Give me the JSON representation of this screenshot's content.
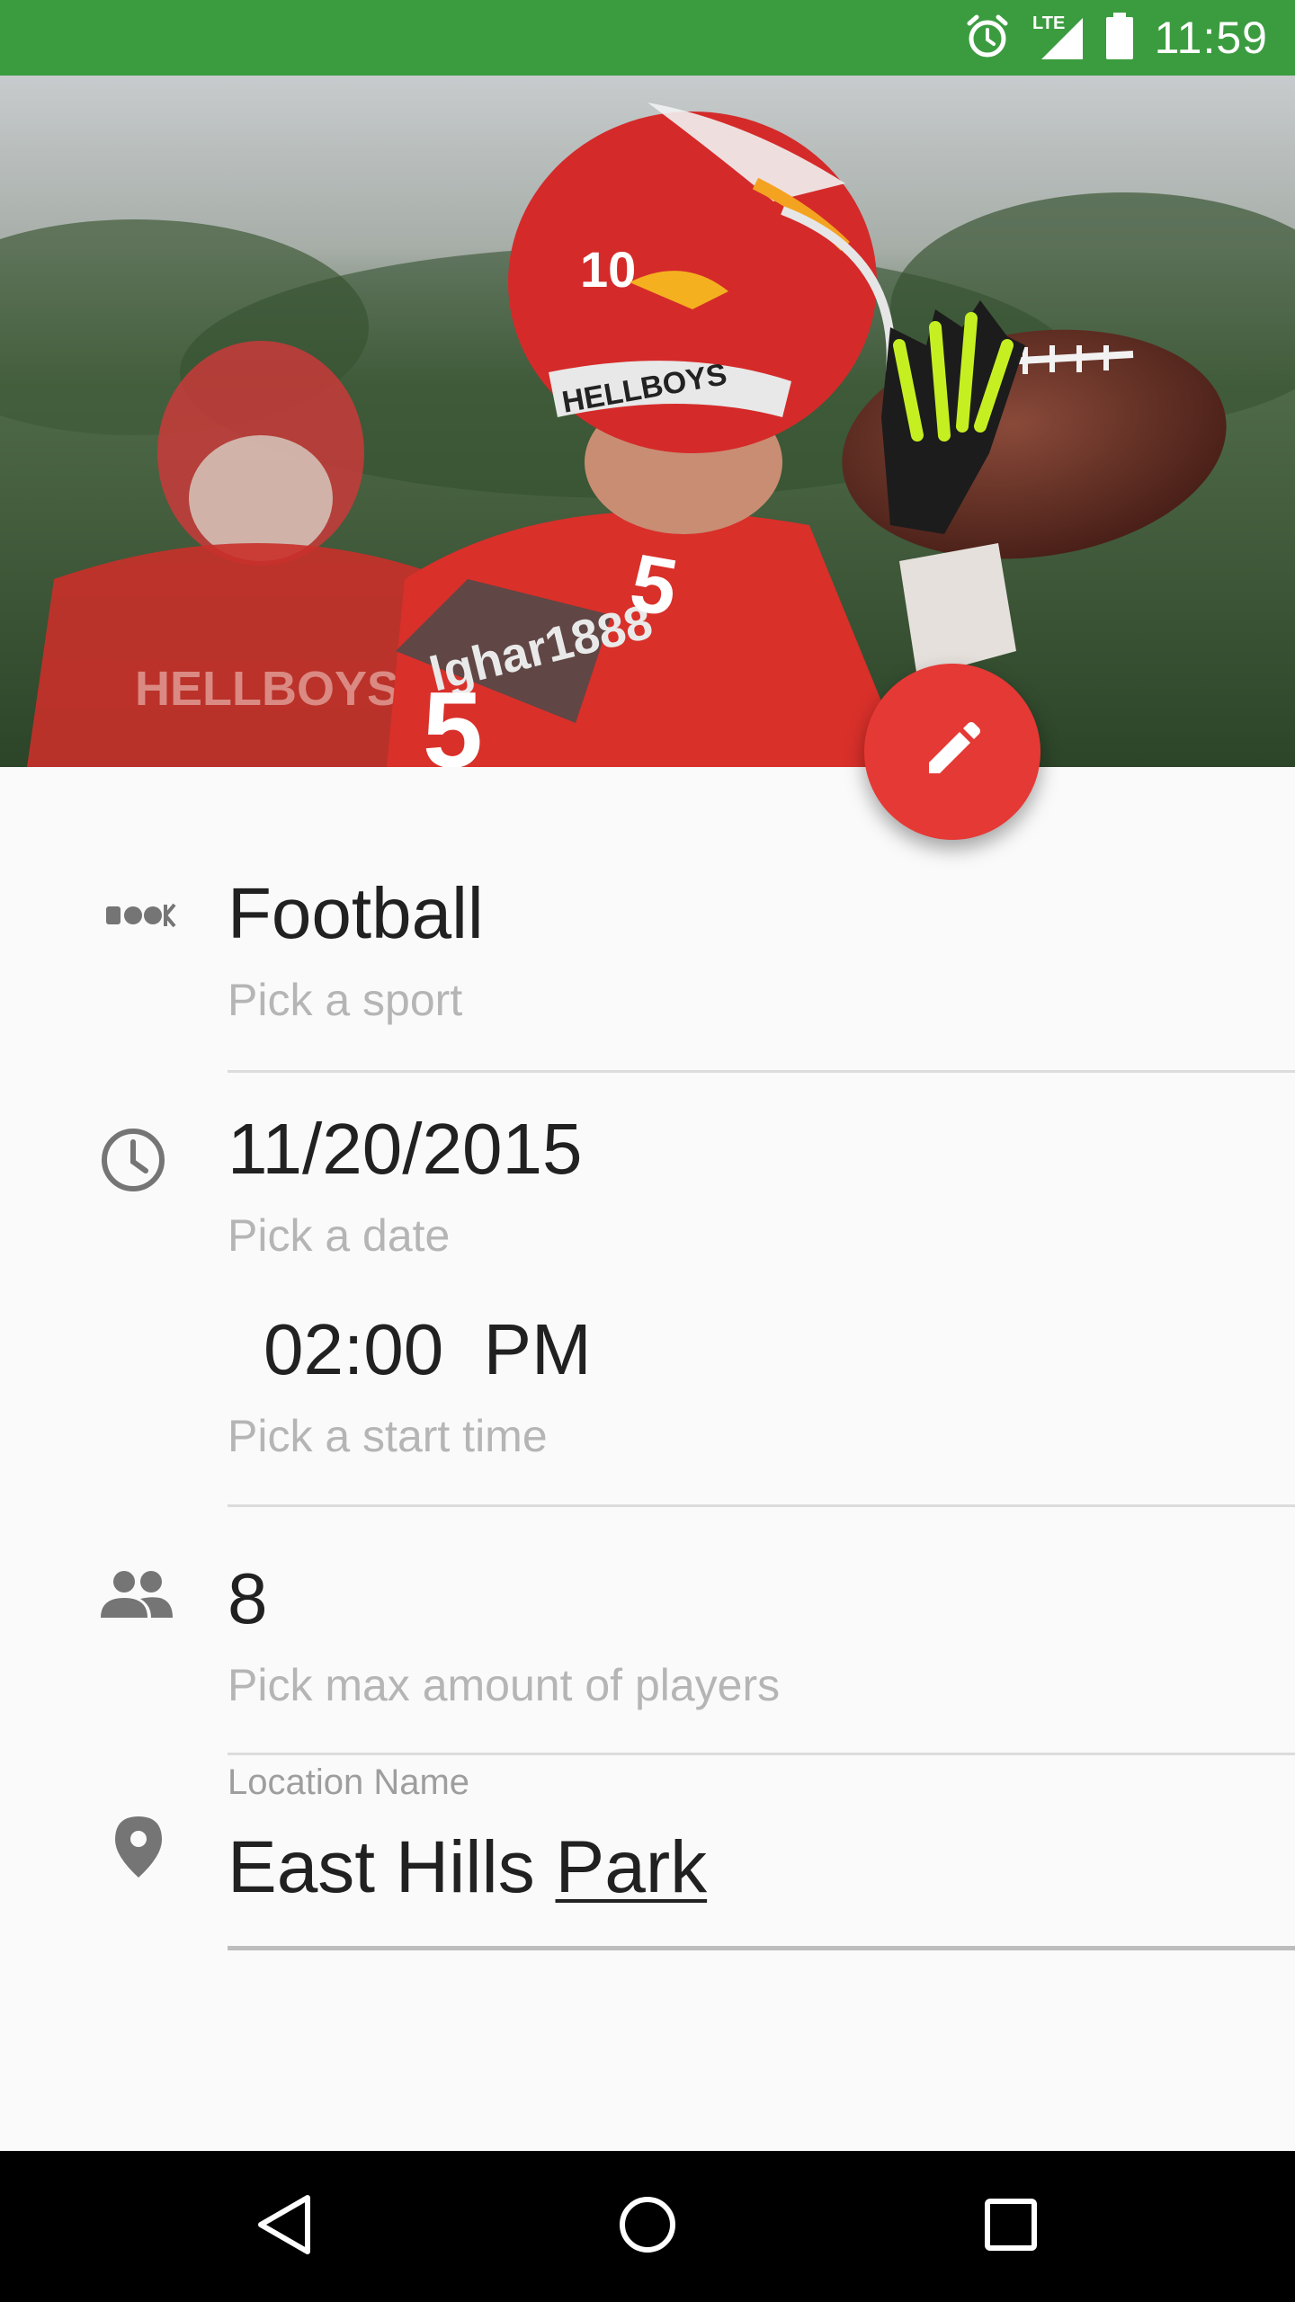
{
  "status_bar": {
    "time": "11:59",
    "icons": [
      "alarm-icon",
      "lte-signal-icon",
      "battery-icon"
    ],
    "network_label": "LTE",
    "color": "#3b9c3f"
  },
  "hero": {
    "jersey_text": "HELLBOYS",
    "jersey_number": "5",
    "helmet_number": "10"
  },
  "fab": {
    "icon": "pencil-icon",
    "color": "#e53935"
  },
  "form": {
    "sport": {
      "value": "Football",
      "hint": "Pick a sport",
      "icon": "sport-icon"
    },
    "date": {
      "value": "11/20/2015",
      "hint": "Pick a date",
      "icon": "clock-icon"
    },
    "time": {
      "value": "02:00  PM",
      "hint": "Pick a start time"
    },
    "players": {
      "value": "8",
      "hint": "Pick max amount of players",
      "icon": "people-icon"
    },
    "location": {
      "label": "Location Name",
      "value_part1": "East Hills ",
      "value_part2": "Park",
      "icon": "location-pin-icon"
    }
  },
  "nav_bar": {
    "back": "back-icon",
    "home": "home-icon",
    "recents": "recents-icon"
  }
}
